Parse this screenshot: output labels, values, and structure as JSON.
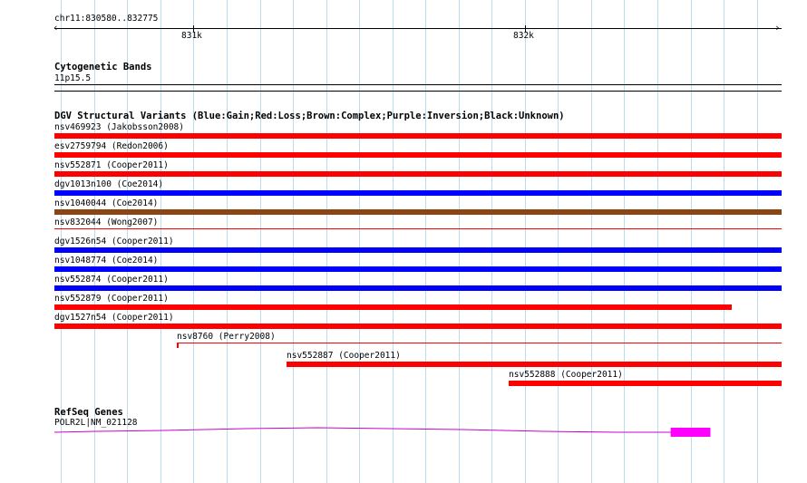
{
  "ruler": {
    "region": "chr11:830580..832775",
    "start": 830580,
    "end": 832775,
    "tick_labels": [
      "831k",
      "832k"
    ],
    "tick_values": [
      831000,
      832000
    ]
  },
  "cytoband_track": {
    "title": "Cytogenetic Bands",
    "band": "11p15.5"
  },
  "dgv_track": {
    "title": "DGV Structural Variants (Blue:Gain;Red:Loss;Brown:Complex;Purple:Inversion;Black:Unknown)",
    "colors": {
      "Gain": "#0000ff",
      "Loss": "#ff0000",
      "Complex": "#8b4513",
      "Inversion": "#800080",
      "Unknown": "#000000"
    },
    "variants": [
      {
        "label": "nsv469923 (Jakobsson2008)",
        "type": "Loss",
        "start": 830580,
        "end": 832775
      },
      {
        "label": "esv2759794 (Redon2006)",
        "type": "Loss",
        "start": 830580,
        "end": 832775
      },
      {
        "label": "nsv552871 (Cooper2011)",
        "type": "Loss",
        "start": 830580,
        "end": 832775
      },
      {
        "label": "dgv1013n100 (Coe2014)",
        "type": "Gain",
        "start": 830580,
        "end": 832775
      },
      {
        "label": "nsv1040044 (Coe2014)",
        "type": "Complex",
        "start": 830580,
        "end": 832775
      },
      {
        "label": "nsv832044 (Wong2007)",
        "type": "Loss",
        "start": 830580,
        "end": 832775,
        "thin": true
      },
      {
        "label": "dgv1526n54 (Cooper2011)",
        "type": "Gain",
        "start": 830580,
        "end": 832775
      },
      {
        "label": "nsv1048774 (Coe2014)",
        "type": "Gain",
        "start": 830580,
        "end": 832775
      },
      {
        "label": "nsv552874 (Cooper2011)",
        "type": "Gain",
        "start": 830580,
        "end": 832775
      },
      {
        "label": "nsv552879 (Cooper2011)",
        "type": "Loss",
        "start": 830580,
        "end": 832625
      },
      {
        "label": "dgv1527n54 (Cooper2011)",
        "type": "Loss",
        "start": 830580,
        "end": 832775
      },
      {
        "label": "nsv8760 (Perry2008)",
        "type": "Loss",
        "start": 830950,
        "end": 832775,
        "thin": true
      },
      {
        "label": "nsv552887 (Cooper2011)",
        "type": "Loss",
        "start": 831280,
        "end": 832775
      },
      {
        "label": "nsv552888 (Cooper2011)",
        "type": "Loss",
        "start": 831950,
        "end": 832775
      }
    ]
  },
  "refseq_track": {
    "title": "RefSeq Genes",
    "gene_label": "POLR2L|NM_021128",
    "gene_color": "#cc00cc",
    "exon_color": "#ff00ff",
    "gene_start": 830580,
    "gene_end": 832560,
    "exon_start": 832440,
    "exon_end": 832560
  }
}
